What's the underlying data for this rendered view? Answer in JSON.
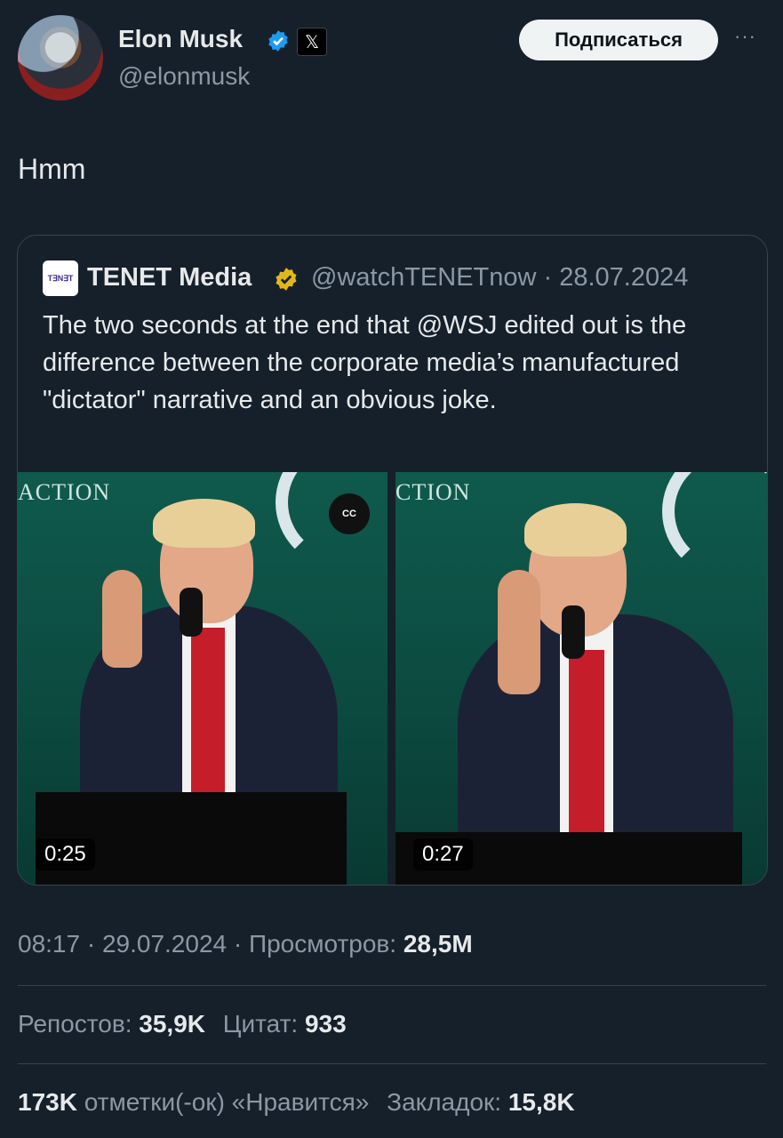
{
  "author": {
    "name": "Elon Musk",
    "handle": "@elonmusk",
    "x_badge": "𝕏",
    "follow_label": "Подписаться",
    "more": "···"
  },
  "tweet": {
    "text": "Hmm"
  },
  "quote": {
    "logo_text": "T∃N∃T",
    "name": "TENET Media",
    "handle_date": "@watchTENETnow · 28.07.2024",
    "text": "The two seconds at the end that @WSJ edited out is the difference between the corporate media’s manufactured \"dictator\" narrative and an obvious joke.",
    "videos": [
      {
        "duration": "0:25",
        "top_text": "ACTION",
        "cc": "CC"
      },
      {
        "duration": "0:27",
        "top_text": "CTION"
      }
    ]
  },
  "meta": {
    "time_date": "08:17 · 29.07.2024 · Просмотров: ",
    "views": "28,5M"
  },
  "stats": {
    "reposts_label": "Репостов: ",
    "reposts": "35,9K",
    "quotes_label": "Цитат: ",
    "quotes": "933",
    "likes": "173K",
    "likes_label": " отметки(-ок) «Нравится»",
    "bookmarks_label": "Закладок: ",
    "bookmarks": "15,8K"
  },
  "colors": {
    "background": "#15202b",
    "verified_blue": "#1d9bf0",
    "verified_gold": "#e2b719",
    "border": "#38444d"
  }
}
